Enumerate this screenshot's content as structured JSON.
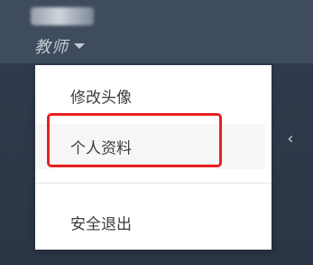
{
  "header": {
    "role_label": "教师"
  },
  "dropdown": {
    "items": [
      {
        "label": "修改头像"
      },
      {
        "label": "个人资料"
      },
      {
        "label": "安全退出"
      }
    ]
  },
  "sidebar": {
    "collapse_glyph": "‹"
  },
  "colors": {
    "topbar": "#3f4c5e",
    "sidebar": "#2f3b4c",
    "highlight": "#e8201e"
  },
  "icons": {
    "caret": "caret-down-icon",
    "collapse": "chevron-left-icon"
  }
}
